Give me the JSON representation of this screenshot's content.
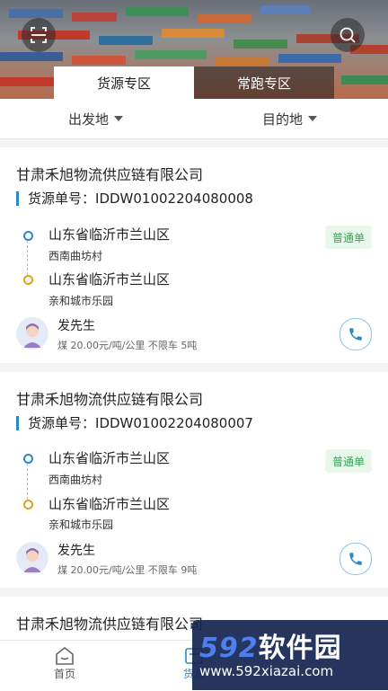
{
  "hero": {
    "scan_icon": "scan-icon",
    "search_icon": "search-icon",
    "tabs": [
      {
        "label": "货源专区",
        "active": true
      },
      {
        "label": "常跑专区",
        "active": false
      }
    ]
  },
  "filters": {
    "origin": "出发地",
    "destination": "目的地"
  },
  "cards": [
    {
      "company": "甘肃禾旭物流供应链有限公司",
      "order_label": "货源单号：",
      "order_no": "IDDW01002204080008",
      "from_city": "山东省临沂市兰山区",
      "from_addr": "西南曲坊村",
      "to_city": "山东省临沂市兰山区",
      "to_addr": "亲和城市乐园",
      "badge": "普通单",
      "shipper": "发先生",
      "meta": "煤 20.00元/吨/公里 不限车 5吨"
    },
    {
      "company": "甘肃禾旭物流供应链有限公司",
      "order_label": "货源单号：",
      "order_no": "IDDW01002204080007",
      "from_city": "山东省临沂市兰山区",
      "from_addr": "西南曲坊村",
      "to_city": "山东省临沂市兰山区",
      "to_addr": "亲和城市乐园",
      "badge": "普通单",
      "shipper": "发先生",
      "meta": "煤 20.00元/吨/公里 不限车 9吨"
    },
    {
      "company": "甘肃禾旭物流供应链有限公司"
    }
  ],
  "nav": {
    "home": "首页",
    "cargo": "货源"
  },
  "watermark": {
    "brand_num": "592",
    "brand_text": "软件园",
    "url": "www.592xiazai.com"
  },
  "colors": {
    "accent": "#2b8ac6",
    "badge_green": "#3aa255",
    "origin_dot": "#2b8ac6",
    "dest_dot": "#e0a21c"
  }
}
